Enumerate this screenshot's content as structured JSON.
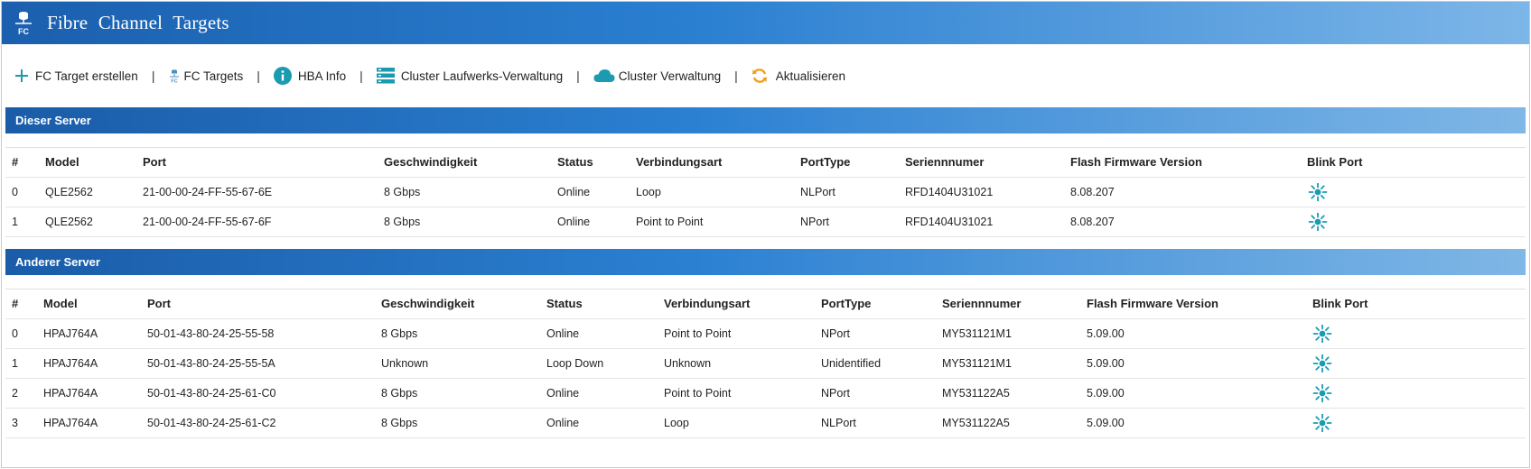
{
  "window": {
    "title": "Fibre Channel Targets",
    "logo_text": "FC"
  },
  "toolbar": {
    "items": [
      {
        "label": "FC Target erstellen",
        "icon": "plus-icon"
      },
      {
        "label": "FC Targets",
        "icon": "fc-target-icon"
      },
      {
        "label": "HBA Info",
        "icon": "info-icon"
      },
      {
        "label": "Cluster Laufwerks-Verwaltung",
        "icon": "cluster-drives-icon"
      },
      {
        "label": "Cluster Verwaltung",
        "icon": "cloud-icon"
      },
      {
        "label": "Aktualisieren",
        "icon": "refresh-icon"
      }
    ],
    "separator": "|"
  },
  "columns": [
    "#",
    "Model",
    "Port",
    "Geschwindigkeit",
    "Status",
    "Verbindungsart",
    "PortType",
    "Seriennnumer",
    "Flash Firmware Version",
    "Blink Port"
  ],
  "sections": [
    {
      "title": "Dieser Server",
      "rows": [
        {
          "idx": "0",
          "model": "QLE2562",
          "port": "21-00-00-24-FF-55-67-6E",
          "speed": "8 Gbps",
          "status": "Online",
          "conn": "Loop",
          "porttype": "NLPort",
          "serial": "RFD1404U31021",
          "firmware": "8.08.207"
        },
        {
          "idx": "1",
          "model": "QLE2562",
          "port": "21-00-00-24-FF-55-67-6F",
          "speed": "8 Gbps",
          "status": "Online",
          "conn": "Point to Point",
          "porttype": "NPort",
          "serial": "RFD1404U31021",
          "firmware": "8.08.207"
        }
      ]
    },
    {
      "title": "Anderer Server",
      "rows": [
        {
          "idx": "0",
          "model": "HPAJ764A",
          "port": "50-01-43-80-24-25-55-58",
          "speed": "8 Gbps",
          "status": "Online",
          "conn": "Point to Point",
          "porttype": "NPort",
          "serial": "MY531121M1",
          "firmware": "5.09.00"
        },
        {
          "idx": "1",
          "model": "HPAJ764A",
          "port": "50-01-43-80-24-25-55-5A",
          "speed": "Unknown",
          "status": "Loop Down",
          "conn": "Unknown",
          "porttype": "Unidentified",
          "serial": "MY531121M1",
          "firmware": "5.09.00"
        },
        {
          "idx": "2",
          "model": "HPAJ764A",
          "port": "50-01-43-80-24-25-61-C0",
          "speed": "8 Gbps",
          "status": "Online",
          "conn": "Point to Point",
          "porttype": "NPort",
          "serial": "MY531122A5",
          "firmware": "5.09.00"
        },
        {
          "idx": "3",
          "model": "HPAJ764A",
          "port": "50-01-43-80-24-25-61-C2",
          "speed": "8 Gbps",
          "status": "Online",
          "conn": "Loop",
          "porttype": "NLPort",
          "serial": "MY531122A5",
          "firmware": "5.09.00"
        }
      ]
    }
  ],
  "colors": {
    "accent": "#1a9bb0",
    "header_dark": "#1b5fae",
    "header_light": "#7db6e8",
    "refresh": "#f0a020"
  }
}
